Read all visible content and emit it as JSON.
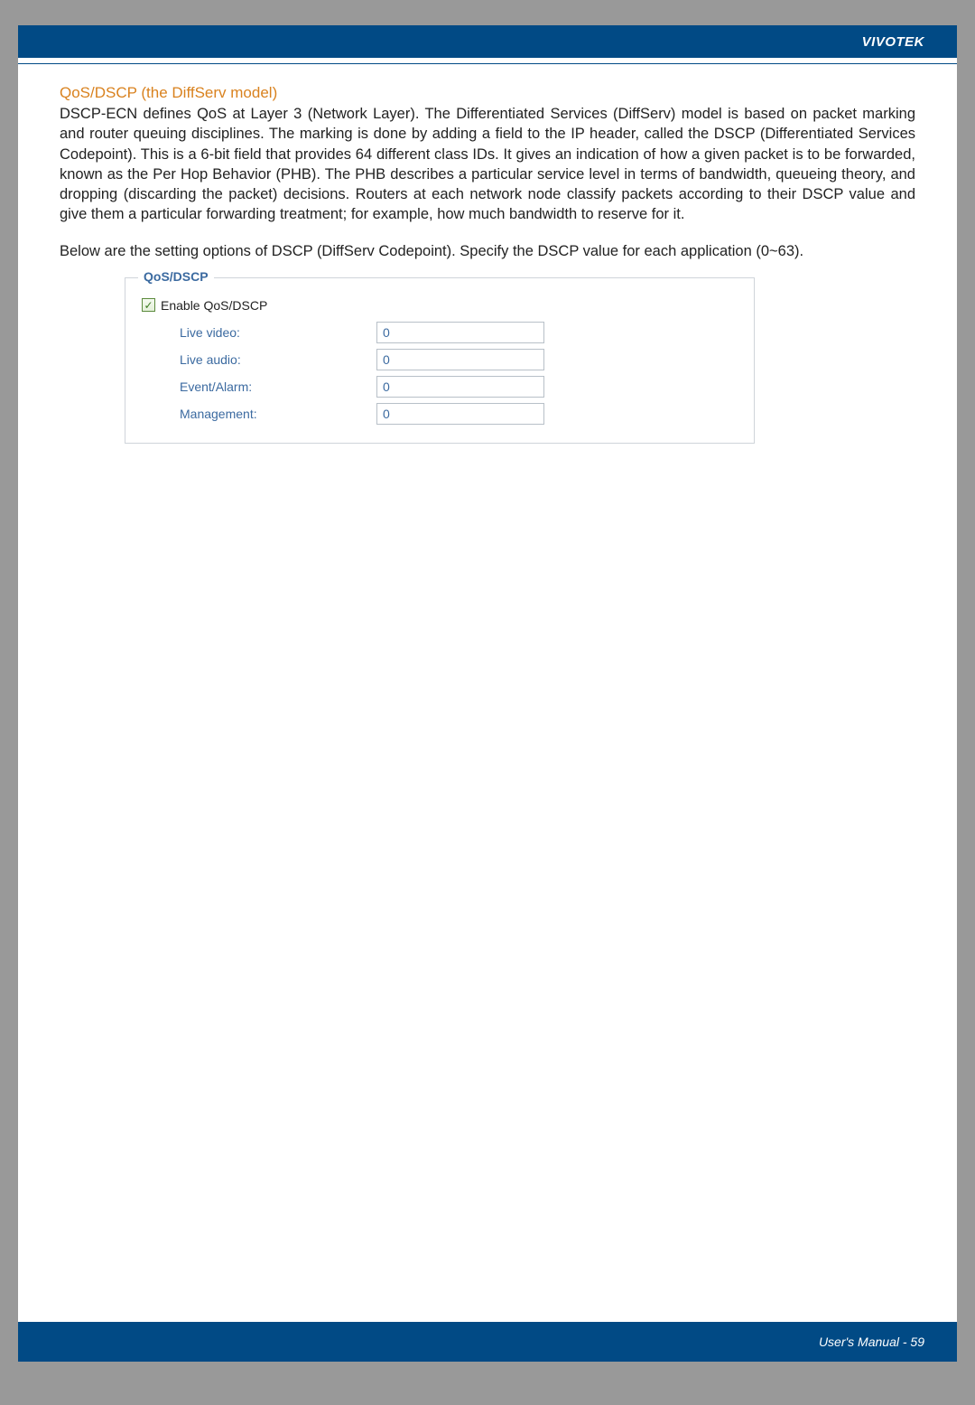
{
  "header": {
    "brand": "VIVOTEK"
  },
  "section": {
    "heading": "QoS/DSCP (the DiffServ model)",
    "para1": "DSCP-ECN defines QoS at Layer 3 (Network Layer). The Differentiated Services (DiffServ) model is based on packet marking and router queuing disciplines. The marking is done by adding a field to the IP header, called the DSCP (Differentiated Services Codepoint). This is a 6-bit field that provides 64 different class IDs. It gives an indication of how a given packet is to be forwarded, known as the Per Hop Behavior (PHB). The PHB describes a particular service level in terms of bandwidth, queueing theory, and dropping (discarding the packet) decisions. Routers at each network node classify packets according to their DSCP value and give them a particular forwarding treatment; for example, how much bandwidth to reserve for it.",
    "para2": "Below are the setting options of DSCP (DiffServ Codepoint). Specify the DSCP value for each application (0~63)."
  },
  "panel": {
    "legend": "QoS/DSCP",
    "enable_label": "Enable QoS/DSCP",
    "checkmark": "✓",
    "fields": {
      "live_video": {
        "label": "Live video:",
        "value": "0"
      },
      "live_audio": {
        "label": "Live audio:",
        "value": "0"
      },
      "event_alarm": {
        "label": "Event/Alarm:",
        "value": "0"
      },
      "management": {
        "label": "Management:",
        "value": "0"
      }
    }
  },
  "footer": {
    "text": "User's Manual - 59"
  }
}
